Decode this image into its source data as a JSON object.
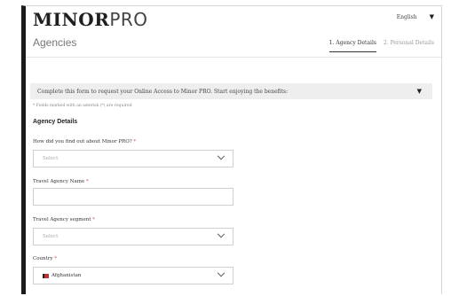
{
  "header": {
    "logo_bold": "MINOR",
    "logo_light": "PRO",
    "language": "English",
    "page_title": "Agencies"
  },
  "tabs": [
    {
      "label": "1. Agency Details",
      "active": true
    },
    {
      "label": "2. Personal Details",
      "active": false
    }
  ],
  "notice": {
    "text": "Complete this form to request your Online Access to Minor PRO. Start enjoying the benefits:"
  },
  "required_note": "* Fields marked with an asterisk (*) are required",
  "section": {
    "title": "Agency Details"
  },
  "fields": {
    "find_out": {
      "label": "How did you find out about Minor PRO?",
      "required_mark": "*",
      "placeholder": "Select"
    },
    "agency_name": {
      "label": "Travel Agency Name",
      "required_mark": "*",
      "value": ""
    },
    "segment": {
      "label": "Travel Agency segment",
      "required_mark": "*",
      "placeholder": "Select"
    },
    "country": {
      "label": "Country",
      "required_mark": "*",
      "value": "Afghanistan",
      "flag_icon": "afghanistan-flag-icon"
    }
  },
  "icons": {
    "language_caret": "caret-down-icon",
    "notice_caret": "caret-down-icon",
    "select_chevron": "chevron-down-icon"
  }
}
